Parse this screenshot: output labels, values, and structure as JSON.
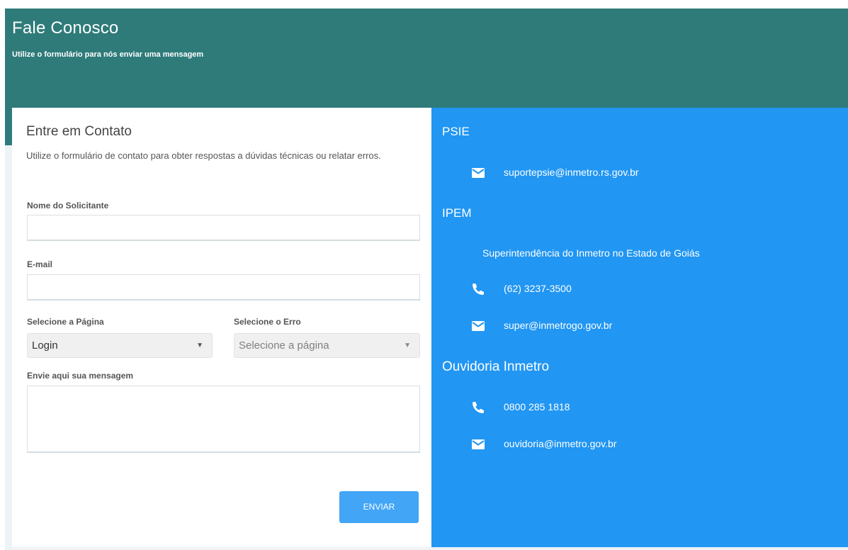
{
  "header": {
    "title": "Fale Conosco",
    "subtitle": "Utilize o formulário para nós enviar uma mensagem"
  },
  "form": {
    "title": "Entre em Contato",
    "description": "Utilize o formulário de contato para obter respostas a dúvidas técnicas ou relatar erros.",
    "name_label": "Nome do Solicitante",
    "name_value": "",
    "email_label": "E-mail",
    "email_value": "",
    "page_select_label": "Selecione a Página",
    "page_select_value": "Login",
    "error_select_label": "Selecione o Erro",
    "error_select_value": "Selecione a página",
    "message_label": "Envie aqui sua mensagem",
    "message_value": "",
    "submit_label": "ENVIAR"
  },
  "info": {
    "psie": {
      "title": "PSIE",
      "email": "suportepsie@inmetro.rs.gov.br"
    },
    "ipem": {
      "title": "IPEM",
      "org": "Superintendência do Inmetro no Estado de Goiás",
      "phone": "(62) 3237-3500",
      "email": "super@inmetrogo.gov.br"
    },
    "ouvidoria": {
      "title": "Ouvidoria Inmetro",
      "phone": "0800 285 1818",
      "email": "ouvidoria@inmetro.gov.br"
    }
  },
  "colors": {
    "header_bg": "#2e7b7a",
    "info_bg": "#2196f3",
    "button_bg": "#42a5f5"
  },
  "icons": {
    "email": "envelope-icon",
    "phone": "phone-icon",
    "dropdown": "caret-down-icon"
  }
}
